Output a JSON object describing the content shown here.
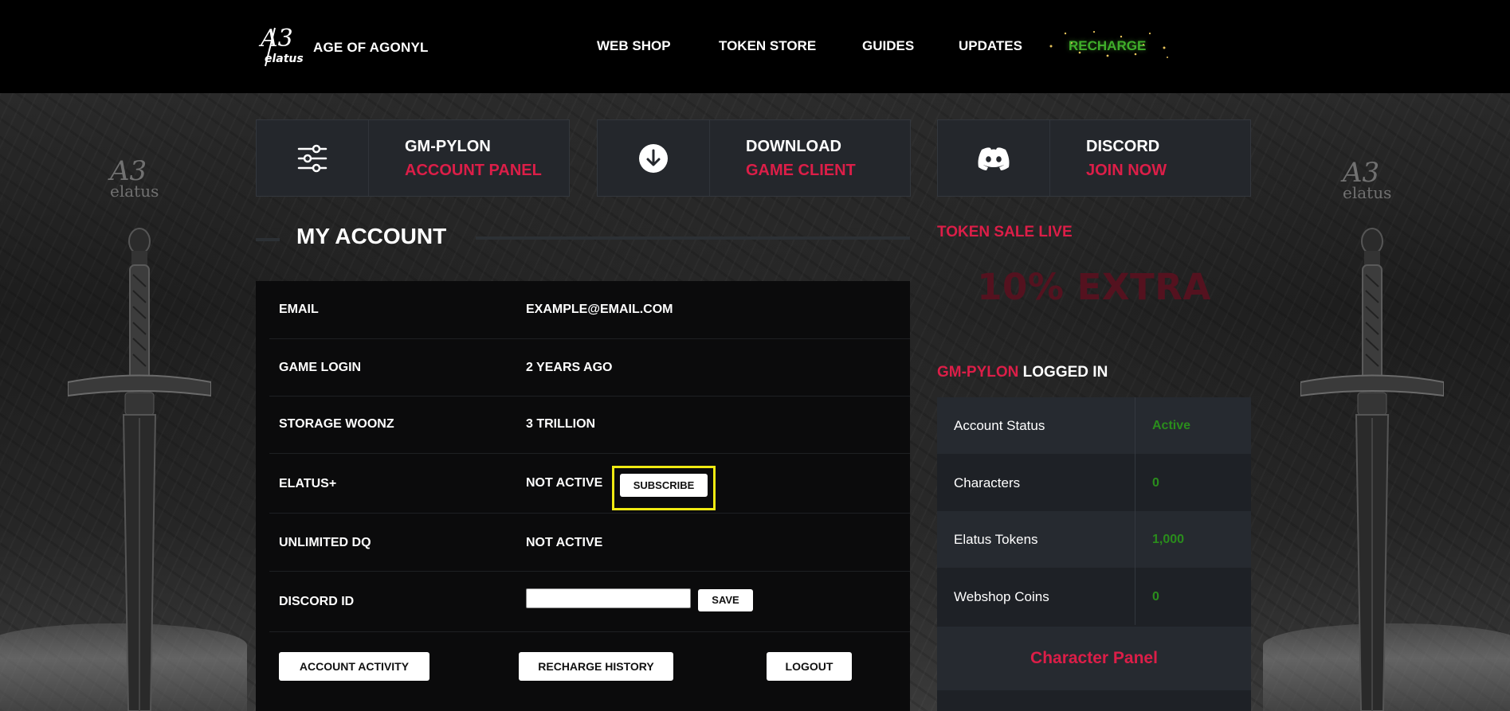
{
  "header": {
    "logo": {
      "mark": "A3",
      "sub": "elatus"
    },
    "brand": "AGE OF AGONYL",
    "nav": [
      {
        "label": "WEB SHOP"
      },
      {
        "label": "TOKEN STORE"
      },
      {
        "label": "GUIDES"
      },
      {
        "label": "UPDATES"
      },
      {
        "label": "RECHARGE"
      }
    ]
  },
  "cards": [
    {
      "icon": "sliders-icon",
      "top": "GM-PYLON",
      "bottom": "ACCOUNT PANEL"
    },
    {
      "icon": "download-icon",
      "top": "DOWNLOAD",
      "bottom": "GAME CLIENT"
    },
    {
      "icon": "discord-icon",
      "top": "DISCORD",
      "bottom": "JOIN NOW"
    }
  ],
  "watermark": {
    "mark": "A3",
    "sub": "elatus"
  },
  "account": {
    "title": "MY ACCOUNT",
    "rows": [
      {
        "label": "EMAIL",
        "value": "EXAMPLE@EMAIL.COM"
      },
      {
        "label": "GAME LOGIN",
        "value": "2 YEARS AGO"
      },
      {
        "label": "STORAGE WOONZ",
        "value": "3 TRILLION"
      },
      {
        "label": "ELATUS+",
        "value": "NOT ACTIVE",
        "button": "SUBSCRIBE"
      },
      {
        "label": "UNLIMITED DQ",
        "value": "NOT ACTIVE"
      },
      {
        "label": "DISCORD ID",
        "input_value": "",
        "button": "SAVE"
      }
    ],
    "actions": {
      "activity": "ACCOUNT ACTIVITY",
      "history": "RECHARGE HISTORY",
      "logout": "LOGOUT"
    }
  },
  "sale": {
    "title": "TOKEN SALE LIVE",
    "headline": "10% EXTRA"
  },
  "status": {
    "user": "GM-PYLON",
    "suffix": "LOGGED IN",
    "rows": [
      {
        "key": "Account Status",
        "value": "Active"
      },
      {
        "key": "Characters",
        "value": "0"
      },
      {
        "key": "Elatus Tokens",
        "value": "1,000"
      },
      {
        "key": "Webshop Coins",
        "value": "0"
      }
    ],
    "character_panel": "Character Panel"
  },
  "colors": {
    "accent_red": "#dc1e48",
    "status_green": "#2a8d1c",
    "recharge_green": "#3fae2a",
    "highlight_yellow": "#f0ea12"
  }
}
